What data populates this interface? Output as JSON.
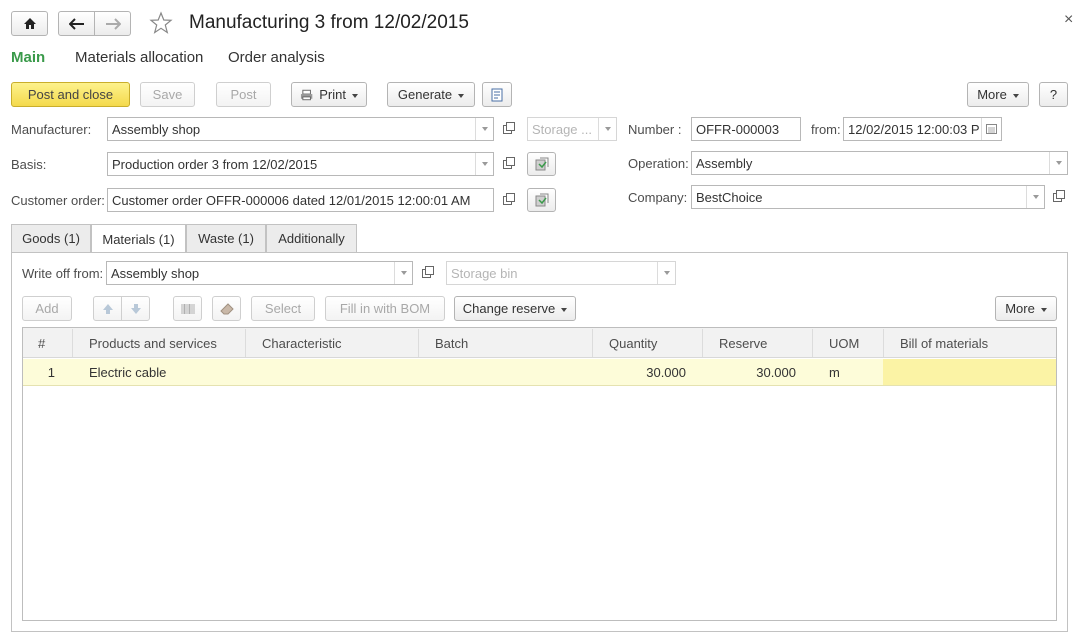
{
  "window": {
    "title": "Manufacturing 3 from 12/02/2015",
    "close_glyph": "×"
  },
  "nav_tabs": {
    "main": "Main",
    "materials_allocation": "Materials allocation",
    "order_analysis": "Order analysis"
  },
  "toolbar": {
    "post_and_close": "Post and close",
    "save": "Save",
    "post": "Post",
    "print": "Print",
    "generate": "Generate",
    "more": "More",
    "help": "?"
  },
  "form": {
    "manufacturer_label": "Manufacturer:",
    "manufacturer_value": "Assembly shop",
    "storage_placeholder": "Storage ...",
    "basis_label": "Basis:",
    "basis_value": "Production order 3 from 12/02/2015",
    "customer_order_label": "Customer order:",
    "customer_order_value": "Customer order OFFR-000006 dated 12/01/2015 12:00:01 AM",
    "number_label": "Number :",
    "number_value": "OFFR-000003",
    "from_label": "from:",
    "from_value": "12/02/2015 12:00:03 P",
    "operation_label": "Operation:",
    "operation_value": "Assembly",
    "company_label": "Company:",
    "company_value": "BestChoice"
  },
  "tabs": [
    {
      "label": "Goods (1)"
    },
    {
      "label": "Materials (1)"
    },
    {
      "label": "Waste (1)"
    },
    {
      "label": "Additionally"
    }
  ],
  "materials": {
    "write_off_label": "Write off from:",
    "write_off_value": "Assembly shop",
    "storage_bin_placeholder": "Storage bin",
    "add": "Add",
    "select": "Select",
    "fill_bom": "Fill in with BOM",
    "change_reserve": "Change reserve",
    "more": "More"
  },
  "table": {
    "headers": [
      "#",
      "Products and services",
      "Characteristic",
      "Batch",
      "Quantity",
      "Reserve",
      "UOM",
      "Bill of materials"
    ],
    "rows": [
      {
        "num": "1",
        "product": "Electric cable",
        "characteristic": "",
        "batch": "",
        "quantity": "30.000",
        "reserve": "30.000",
        "uom": "m",
        "bom": ""
      }
    ]
  },
  "colors": {
    "accent_green": "#3a9a4a",
    "primary_button": "#f4d94c",
    "selected_row": "#fdfcd9",
    "bom_cell": "#fbf3a5"
  }
}
